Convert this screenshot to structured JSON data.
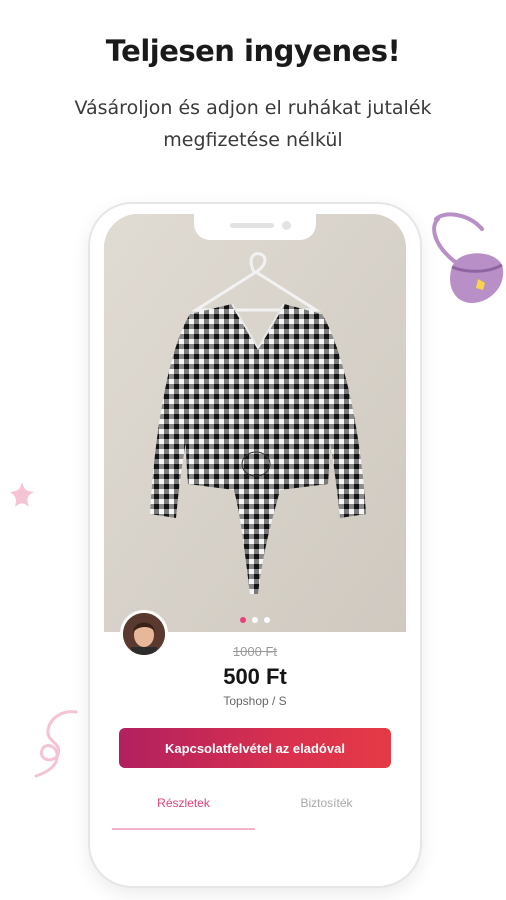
{
  "header": {
    "title": "Teljesen ingyenes!",
    "subtitle_line1": "Vásároljon és adjon el ruhákat jutalék",
    "subtitle_line2": "megfizetése nélkül"
  },
  "product": {
    "image_carousel": {
      "count": 3,
      "active_index": 1
    },
    "original_price": "1000 Ft",
    "price": "500 Ft",
    "brand_size": "Topshop / S"
  },
  "actions": {
    "contact_label": "Kapcsolatfelvétel az eladóval"
  },
  "tabs": [
    {
      "label": "Részletek",
      "active": true
    },
    {
      "label": "Biztosíték",
      "active": false
    }
  ],
  "colors": {
    "accent_pink": "#e23f76",
    "button_gradient_start": "#b2205f",
    "button_gradient_end": "#e53a45",
    "deco_purple": "#b98fc8",
    "deco_pink": "#f4c3d4"
  },
  "decor_icons": [
    "handbag-icon",
    "star-icon",
    "swirl-icon"
  ]
}
